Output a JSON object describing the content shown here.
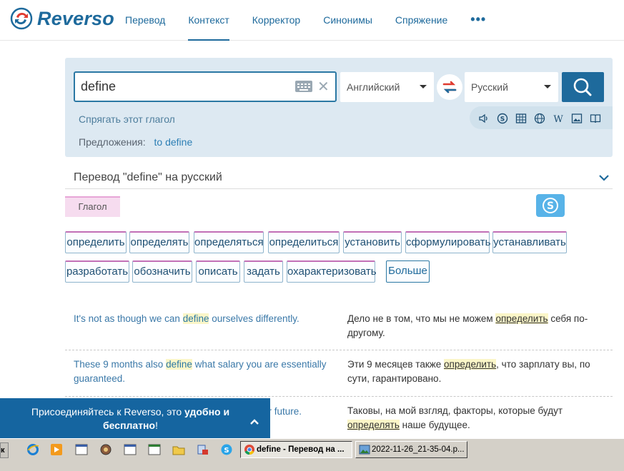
{
  "brand": {
    "name": "Reverso"
  },
  "nav": {
    "items": [
      {
        "label": "Перевод"
      },
      {
        "label": "Контекст"
      },
      {
        "label": "Корректор"
      },
      {
        "label": "Синонимы"
      },
      {
        "label": "Спряжение"
      }
    ],
    "more": "•••"
  },
  "search": {
    "value": "define",
    "source_lang": "Английский",
    "target_lang": "Русский",
    "conjugate_link": "Спрягать этот глагол",
    "suggestions_label": "Предложения:",
    "suggestion": "to define"
  },
  "translation": {
    "title": "Перевод \"define\" на русский",
    "pos": "Глагол",
    "chips_row1": [
      "определить",
      "определять",
      "определяться",
      "определиться",
      "установить",
      "сформулировать",
      "устанавливать"
    ],
    "chips_row2": [
      "разработать",
      "обозначить",
      "описать",
      "задать",
      "охарактеризовать"
    ],
    "more": "Больше"
  },
  "examples": [
    {
      "src_before": "It's not as though we can ",
      "src_hl": "define",
      "src_after": " ourselves differently.",
      "trg_before": "Дело не в том, что мы не можем ",
      "trg_hl": "определить",
      "trg_after": " себя по-другому."
    },
    {
      "src_before": "These 9 months also ",
      "src_hl": "define",
      "src_after": " what salary you are essentially guaranteed.",
      "trg_before": "Эти 9 месяцев также ",
      "trg_hl": "определить",
      "trg_after": ", что зарплату вы, по сути, гарантировано."
    },
    {
      "src_visible": "ur future.",
      "trg_before": "Таковы, на мой взгляд, факторы, которые будут ",
      "trg_hl": "определять",
      "trg_after": " наше будущее."
    }
  ],
  "banner": {
    "text_plain": "Присоединяйтесь к Reverso, это ",
    "text_bold1": "удобно и",
    "text_bold2": "бесплатно",
    "text_end": "!"
  },
  "taskbar": {
    "start_label": "к",
    "tasks": [
      {
        "label": "define - Перевод на ..."
      },
      {
        "label": "2022-11-26_21-35-04.p..."
      }
    ]
  },
  "colors": {
    "brand_blue": "#1e6a9c",
    "panel_bg": "#dde9f2",
    "highlight": "#fbf6c8",
    "banner_bg": "#1565a0"
  }
}
